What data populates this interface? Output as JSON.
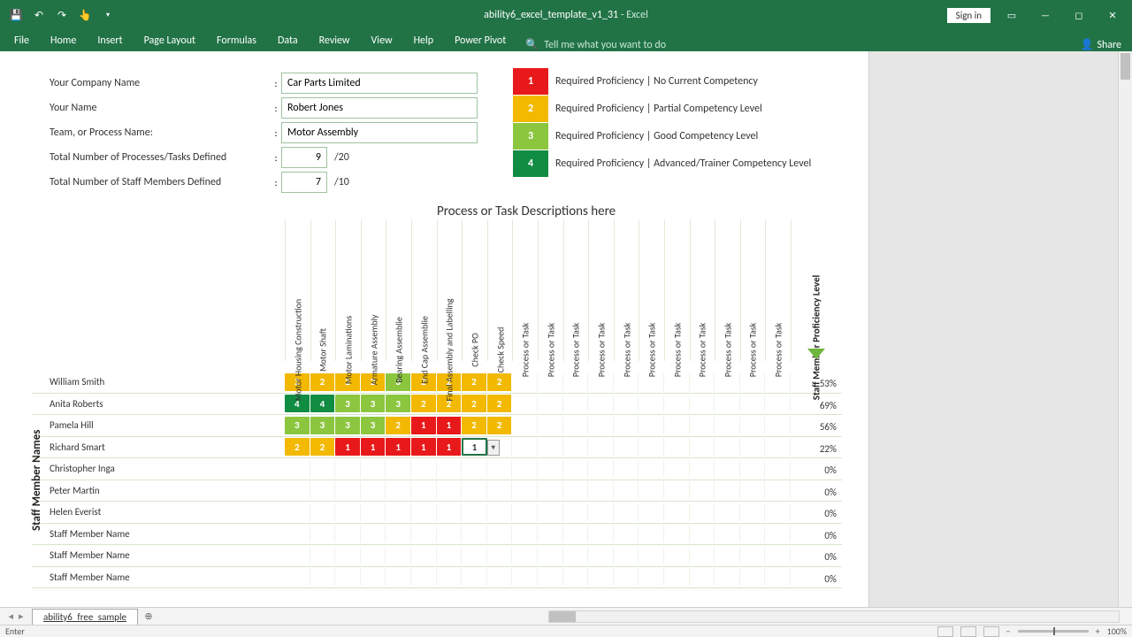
{
  "window": {
    "filename": "ability6_excel_template_v1_31",
    "app": "Excel",
    "signin": "Sign in"
  },
  "ribbon": {
    "tabs": [
      "File",
      "Home",
      "Insert",
      "Page Layout",
      "Formulas",
      "Data",
      "Review",
      "View",
      "Help",
      "Power Pivot"
    ],
    "search_placeholder": "Tell me what you want to do",
    "share": "Share"
  },
  "form": {
    "company_label": "Your Company Name",
    "company_value": "Car Parts Limited",
    "name_label": "Your Name",
    "name_value": "Robert Jones",
    "team_label": "Team, or Process Name:",
    "team_value": "Motor Assembly",
    "processes_label": "Total Number of Processes/Tasks Defined",
    "processes_value": "9",
    "processes_max": "/20",
    "staff_label": "Total Number of Staff Members Defined",
    "staff_value": "7",
    "staff_max": "/10"
  },
  "legend": [
    {
      "n": "1",
      "color": "#e8191a",
      "text": "Required Proficiency | No Current Competency"
    },
    {
      "n": "2",
      "color": "#f2b900",
      "text": "Required Proficiency | Partial Competency Level"
    },
    {
      "n": "3",
      "color": "#8cc63f",
      "text": "Required Proficiency | Good Competency Level"
    },
    {
      "n": "4",
      "color": "#118c43",
      "text": "Required Proficiency | Advanced/Trainer Competency Level"
    }
  ],
  "matrix": {
    "title": "Process or Task Descriptions here",
    "row_group_label": "Staff Member Names",
    "prof_header": "Staff Member Proficiency Level",
    "columns": [
      "Motor Housing Construction",
      "Motor Shaft",
      "Motor Laminations",
      "Armature Assembly",
      "Bearing Assemblie",
      "End Cap Assemblie",
      "Final Assembly and Labelling",
      "Check PO",
      "Check Speed",
      "Process or Task",
      "Process or Task",
      "Process or Task",
      "Process or Task",
      "Process or Task",
      "Process or Task",
      "Process or Task",
      "Process or Task",
      "Process or Task",
      "Process or Task",
      "Process or Task"
    ],
    "rows": [
      {
        "name": "William Smith",
        "cells": [
          2,
          2,
          2,
          2,
          3,
          2,
          2,
          2,
          2
        ],
        "pct": "53%"
      },
      {
        "name": "Anita Roberts",
        "cells": [
          4,
          4,
          3,
          3,
          3,
          2,
          2,
          2,
          2
        ],
        "pct": "69%"
      },
      {
        "name": "Pamela Hill",
        "cells": [
          3,
          3,
          3,
          3,
          2,
          1,
          1,
          2,
          2
        ],
        "pct": "56%"
      },
      {
        "name": "Richard Smart",
        "cells": [
          2,
          2,
          1,
          1,
          1,
          1,
          1,
          "edit:1"
        ],
        "pct": "22%"
      },
      {
        "name": "Christopher Inga",
        "cells": [],
        "pct": "0%"
      },
      {
        "name": "Peter Martin",
        "cells": [],
        "pct": "0%"
      },
      {
        "name": "Helen Everist",
        "cells": [],
        "pct": "0%"
      },
      {
        "name": "Staff Member Name",
        "cells": [],
        "pct": "0%"
      },
      {
        "name": "Staff Member Name",
        "cells": [],
        "pct": "0%"
      },
      {
        "name": "Staff Member Name",
        "cells": [],
        "pct": "0%"
      }
    ]
  },
  "sheet_tab": "ability6_free_sample",
  "status": {
    "mode": "Enter",
    "zoom": "100%"
  }
}
